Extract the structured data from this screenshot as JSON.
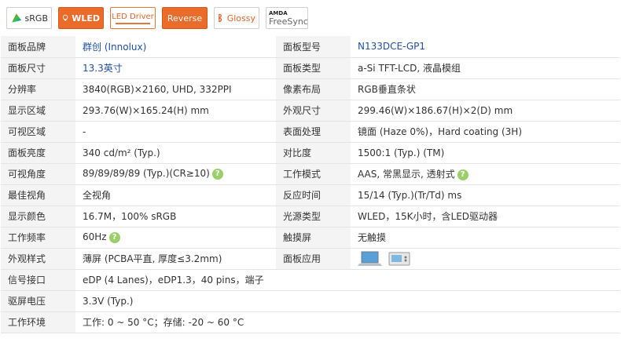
{
  "badges": {
    "srgb": "sRGB",
    "wled": "WLED",
    "led_driver": "LED Driver",
    "reverse": "Reverse",
    "glossy": "Glossy",
    "amd_top": "AMDA",
    "amd_bottom": "FreeSync"
  },
  "rows": [
    {
      "l1": "面板品牌",
      "v1": "群创 (Innolux)",
      "l2": "面板型号",
      "v2": "N133DCE-GP1"
    },
    {
      "l1": "面板尺寸",
      "v1": "13.3英寸",
      "l2": "面板类型",
      "v2": "a-Si TFT-LCD, 液晶模组"
    },
    {
      "l1": "分辨率",
      "v1": "3840(RGB)×2160, UHD, 332PPI",
      "l2": "像素布局",
      "v2": "RGB垂直条状"
    },
    {
      "l1": "显示区域",
      "v1": "293.76(W)×165.24(H) mm",
      "l2": "外观尺寸",
      "v2": "299.46(W)×186.67(H)×2(D) mm"
    },
    {
      "l1": "可视区域",
      "v1": "-",
      "l2": "表面处理",
      "v2": "镜面 (Haze 0%)，Hard coating (3H)"
    },
    {
      "l1": "面板亮度",
      "v1": "340 cd/m² (Typ.)",
      "l2": "对比度",
      "v2": "1500:1 (Typ.) (TM)"
    },
    {
      "l1": "可视角度",
      "v1": "89/89/89/89 (Typ.)(CR≥10)",
      "l2": "工作模式",
      "v2": "AAS, 常黑显示, 透射式"
    },
    {
      "l1": "最佳视角",
      "v1": "全视角",
      "l2": "反应时间",
      "v2": "15/14 (Typ.)(Tr/Td) ms"
    },
    {
      "l1": "显示颜色",
      "v1": "16.7M，100% sRGB",
      "l2": "光源类型",
      "v2": "WLED，15K小时，含LED驱动器"
    },
    {
      "l1": "工作频率",
      "v1": "60Hz",
      "l2": "触摸屏",
      "v2": "无触摸"
    },
    {
      "l1": "外观样式",
      "v1": "薄屏 (PCBA平直, 厚度≤3.2mm)",
      "l2": "面板应用",
      "v2": ""
    },
    {
      "l1": "信号接口",
      "v1": "eDP (4 Lanes)，eDP1.3，40 pins，端子"
    },
    {
      "l1": "驱屏电压",
      "v1": "3.3V (Typ.)"
    },
    {
      "l1": "工作环境",
      "v1": "工作: 0 ~ 50 °C；存储: -20 ~ 60 °C"
    }
  ],
  "help_glyph": "?",
  "colors": {
    "accent": "#ea6b2a",
    "link": "#1e50a2",
    "label_bg": "#f4f4f4",
    "help": "#9bcf6a"
  }
}
